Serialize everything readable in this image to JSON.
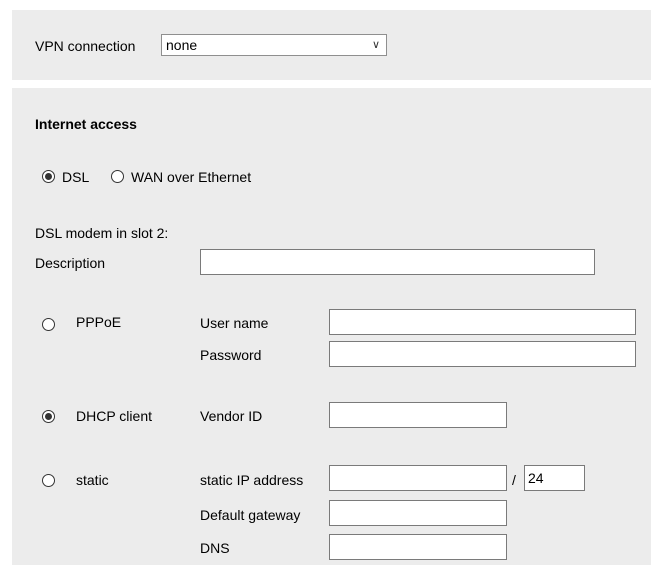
{
  "vpn": {
    "label": "VPN connection",
    "selected": "none",
    "chevron_icon": "chevron-down-icon"
  },
  "internet": {
    "heading": "Internet access",
    "mode_dsl_label": "DSL",
    "mode_dsl_selected": true,
    "mode_wan_label": "WAN over Ethernet",
    "mode_wan_selected": false,
    "dsl_modem_label": "DSL modem in slot 2:",
    "description_label": "Description",
    "description_value": "",
    "pppoe": {
      "label": "PPPoE",
      "selected": false,
      "user_name_label": "User name",
      "user_name_value": "",
      "password_label": "Password",
      "password_value": ""
    },
    "dhcp": {
      "label": "DHCP client",
      "selected": true,
      "vendor_id_label": "Vendor ID",
      "vendor_id_value": ""
    },
    "static": {
      "label": "static",
      "selected": false,
      "ip_label": "static IP address",
      "ip_value": "",
      "prefix_separator": "/",
      "prefix_value": "24",
      "gateway_label": "Default gateway",
      "gateway_value": "",
      "dns_label": "DNS",
      "dns_value": ""
    }
  }
}
